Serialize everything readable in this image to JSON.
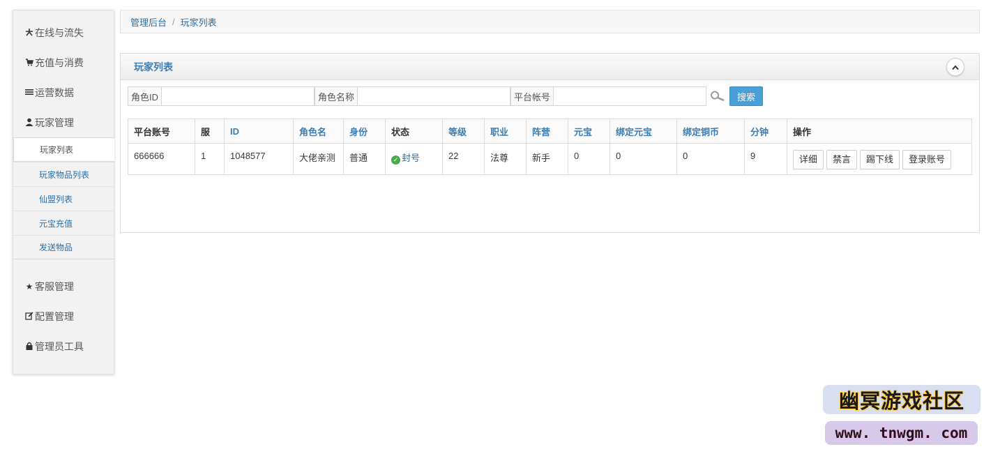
{
  "sidebar": {
    "items": [
      {
        "label": "在线与流失",
        "icon": "user-chart-icon"
      },
      {
        "label": "充值与消费",
        "icon": "cart-icon"
      },
      {
        "label": "运营数据",
        "icon": "list-icon"
      },
      {
        "label": "玩家管理",
        "icon": "user-icon"
      },
      {
        "label": "客服管理",
        "icon": "star-icon"
      },
      {
        "label": "配置管理",
        "icon": "edit-icon"
      },
      {
        "label": "管理员工具",
        "icon": "lock-icon"
      }
    ],
    "subitems": [
      {
        "label": "玩家列表",
        "active": true
      },
      {
        "label": "玩家物品列表"
      },
      {
        "label": "仙盟列表"
      },
      {
        "label": "元宝充值"
      },
      {
        "label": "发送物品"
      }
    ]
  },
  "breadcrumb": {
    "root": "管理后台",
    "separator": "/",
    "current": "玩家列表"
  },
  "panel": {
    "title": "玩家列表"
  },
  "search": {
    "role_id_label": "角色ID",
    "role_id_value": "",
    "role_name_label": "角色名称",
    "role_name_value": "",
    "platform_label": "平台帐号",
    "platform_value": "",
    "button": "搜索"
  },
  "table": {
    "headers": [
      "平台账号",
      "服",
      "ID",
      "角色名",
      "身份",
      "状态",
      "等级",
      "职业",
      "阵营",
      "元宝",
      "绑定元宝",
      "绑定铜币",
      "分钟",
      "操作"
    ],
    "rows": [
      {
        "platform_account": "666666",
        "server": "1",
        "id": "1048577",
        "role_name": "大佬亲测",
        "identity": "普通",
        "status": "封号",
        "level": "22",
        "profession": "法尊",
        "camp": "新手",
        "yuanbao": "0",
        "bound_yuanbao": "0",
        "bound_copper": "0",
        "minutes": "9",
        "actions": [
          "详细",
          "禁言",
          "踢下线",
          "登录账号"
        ]
      }
    ]
  },
  "watermark": {
    "title": "幽冥游戏社区",
    "url": "www. tnwgm. com"
  },
  "colors": {
    "link": "#2a6fa8",
    "primary_button": "#4a9fd6",
    "status_ok": "#4ca84c"
  }
}
